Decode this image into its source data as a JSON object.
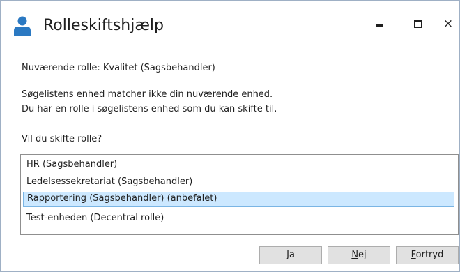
{
  "window": {
    "title": "Rolleskiftshjælp",
    "icon": "user-icon",
    "controls": {
      "minimize": "minimize-icon",
      "maximize": "maximize-icon",
      "close": "×"
    }
  },
  "content": {
    "current_role": "Nuværende rolle: Kvalitet (Sagsbehandler)",
    "message_line1": "Søgelistens enhed matcher ikke din nuværende enhed.",
    "message_line2": "Du har en rolle i søgelistens enhed som du kan skifte til.",
    "question": "Vil du skifte rolle?"
  },
  "roles": {
    "items": [
      {
        "label": "HR (Sagsbehandler)",
        "selected": false
      },
      {
        "label": "Ledelsessekretariat (Sagsbehandler)",
        "selected": false
      },
      {
        "label": "Rapportering (Sagsbehandler) (anbefalet)",
        "selected": true
      },
      {
        "label": "Test-enheden (Decentral rolle)",
        "selected": false
      }
    ]
  },
  "buttons": {
    "yes": {
      "mnemonic": "J",
      "rest": "a"
    },
    "no": {
      "mnemonic": "N",
      "rest": "ej"
    },
    "cancel": {
      "mnemonic": "F",
      "rest": "ortryd"
    }
  },
  "colors": {
    "selection_bg": "#cce8ff",
    "selection_border": "#7ab5e4",
    "icon_blue": "#2b79c2"
  }
}
